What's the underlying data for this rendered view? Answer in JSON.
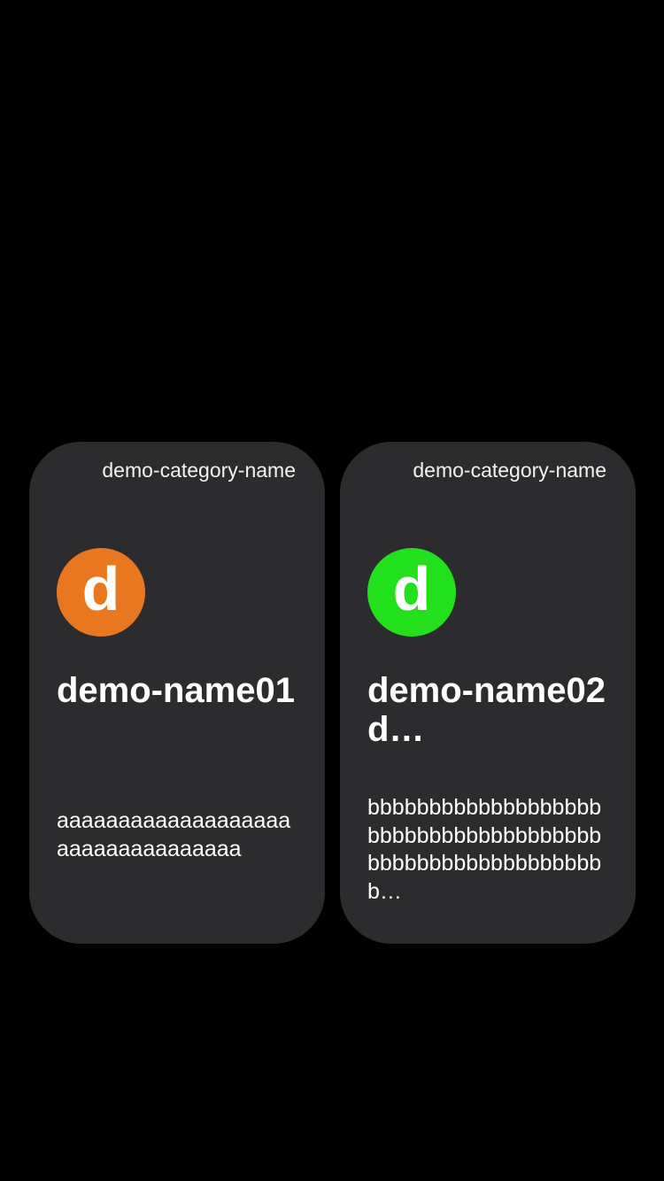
{
  "cards": [
    {
      "category": "demo-category-name",
      "avatar_letter": "d",
      "avatar_color": "#e9771f",
      "name": "demo-name01",
      "description": "aaaaaaaaaaaaaaaaaaaaaaaaaaaaaaaaaa"
    },
    {
      "category": "demo-category-name",
      "avatar_letter": "d",
      "avatar_color": "#22e01b",
      "name": "demo-name02 d…",
      "description": "bbbbbbbbbbbbbbbbbbbbbbbbbbbbbbbbbbbbbbbbbbbbbbbbbbbbbbbbbb…"
    }
  ]
}
